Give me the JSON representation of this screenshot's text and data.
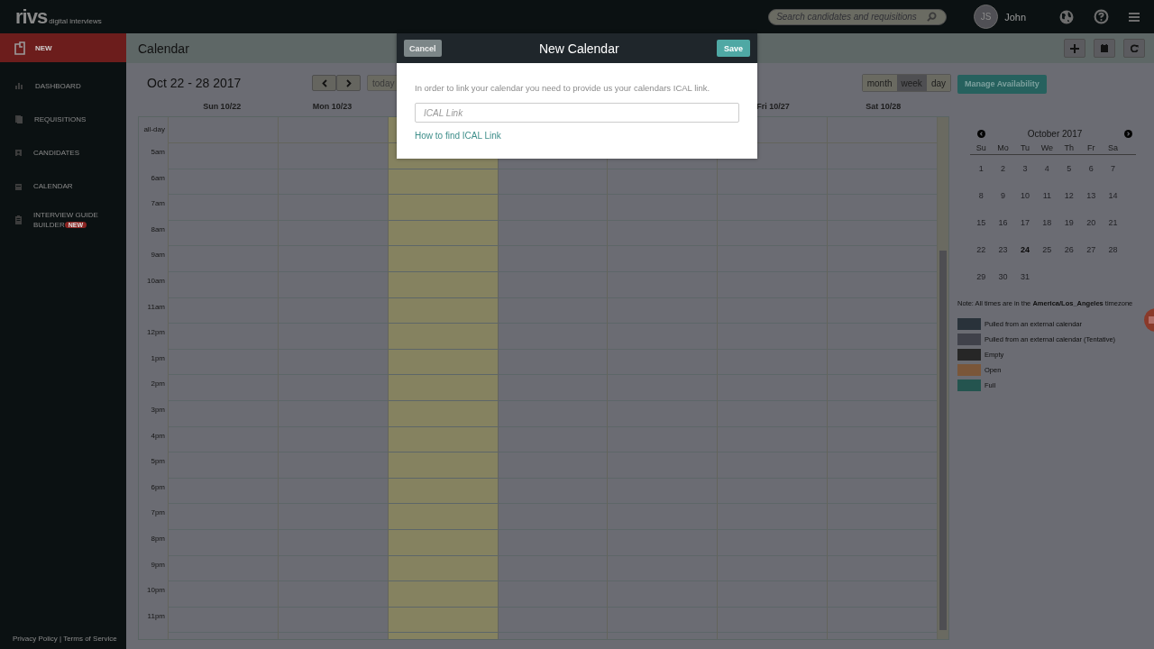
{
  "topbar": {
    "logo": "rivs",
    "logo_tagline": "digital interviews",
    "search": {
      "placeholder": "Search candidates and requisitions"
    },
    "user": {
      "initials": "JS",
      "name": "John"
    }
  },
  "sidebar": {
    "items": [
      {
        "label": "NEW",
        "selected": true
      },
      {
        "label": "DASHBOARD",
        "selected": false
      },
      {
        "label": "REQUISITIONS",
        "selected": false
      },
      {
        "label": "CANDIDATES",
        "selected": false
      },
      {
        "label": "CALENDAR",
        "selected": false
      },
      {
        "label": "INTERVIEW GUIDE BUILDER",
        "selected": false,
        "badge": "NEW"
      }
    ],
    "footer": "Privacy Policy | Terms of Service"
  },
  "page": {
    "title": "Calendar"
  },
  "calendar": {
    "range": "Oct 22 - 28 2017",
    "today_button": "today",
    "views": [
      {
        "label": "month",
        "selected": false
      },
      {
        "label": "week",
        "selected": true
      },
      {
        "label": "day",
        "selected": false
      }
    ],
    "manage_button": "Manage Availability",
    "allday_label": "all-day",
    "days": [
      {
        "header": "Sun 10/22",
        "today": false
      },
      {
        "header": "Mon 10/23",
        "today": false
      },
      {
        "today": true
      },
      {
        "today": false
      },
      {
        "today": false
      },
      {
        "header": "Fri 10/27",
        "today": false
      },
      {
        "header": "Sat 10/28",
        "today": false
      }
    ],
    "hours": [
      "5am",
      "6am",
      "7am",
      "8am",
      "9am",
      "10am",
      "11am",
      "12pm",
      "1pm",
      "2pm",
      "3pm",
      "4pm",
      "5pm",
      "6pm",
      "7pm",
      "8pm",
      "9pm",
      "10pm",
      "11pm"
    ]
  },
  "mini_calendar": {
    "month": "October 2017",
    "weekdays": [
      "Su",
      "Mo",
      "Tu",
      "We",
      "Th",
      "Fr",
      "Sa"
    ],
    "weeks": [
      [
        {
          "day": "1",
          "today": false
        },
        {
          "day": "2",
          "today": false
        },
        {
          "day": "3",
          "today": false
        },
        {
          "day": "4",
          "today": false
        },
        {
          "day": "5",
          "today": false
        },
        {
          "day": "6",
          "today": false
        },
        {
          "day": "7",
          "today": false
        }
      ],
      [
        {
          "day": "8",
          "today": false
        },
        {
          "day": "9",
          "today": false
        },
        {
          "day": "10",
          "today": false
        },
        {
          "day": "11",
          "today": false
        },
        {
          "day": "12",
          "today": false
        },
        {
          "day": "13",
          "today": false
        },
        {
          "day": "14",
          "today": false
        }
      ],
      [
        {
          "day": "15",
          "today": false
        },
        {
          "day": "16",
          "today": false
        },
        {
          "day": "17",
          "today": false
        },
        {
          "day": "18",
          "today": false
        },
        {
          "day": "19",
          "today": false
        },
        {
          "day": "20",
          "today": false
        },
        {
          "day": "21",
          "today": false
        }
      ],
      [
        {
          "day": "22",
          "today": false
        },
        {
          "day": "23",
          "today": false
        },
        {
          "day": "24",
          "today": true
        },
        {
          "day": "25",
          "today": false
        },
        {
          "day": "26",
          "today": false
        },
        {
          "day": "27",
          "today": false
        },
        {
          "day": "28",
          "today": false
        }
      ],
      [
        {
          "day": "29",
          "today": false
        },
        {
          "day": "30",
          "today": false
        },
        {
          "day": "31",
          "today": false
        }
      ]
    ]
  },
  "timezone_note": "Note: All times are in the **America/Los_Angeles** timezone",
  "legend": [
    {
      "label": "Pulled from an external calendar",
      "color": "#29323a"
    },
    {
      "label": "Pulled from an external calendar (Tentative)",
      "color": "#40414a"
    },
    {
      "label": "Empty",
      "color": "#262626"
    },
    {
      "label": "Open",
      "color": "#7a5639"
    },
    {
      "label": "Full",
      "color": "#24544f"
    }
  ],
  "modal": {
    "title": "New Calendar",
    "cancel": "Cancel",
    "save": "Save",
    "text": "In order to link your calendar you need to provide us your calendars ICAL link.",
    "field": {
      "placeholder": "ICAL Link"
    },
    "help_link": "How to find ICAL Link"
  }
}
